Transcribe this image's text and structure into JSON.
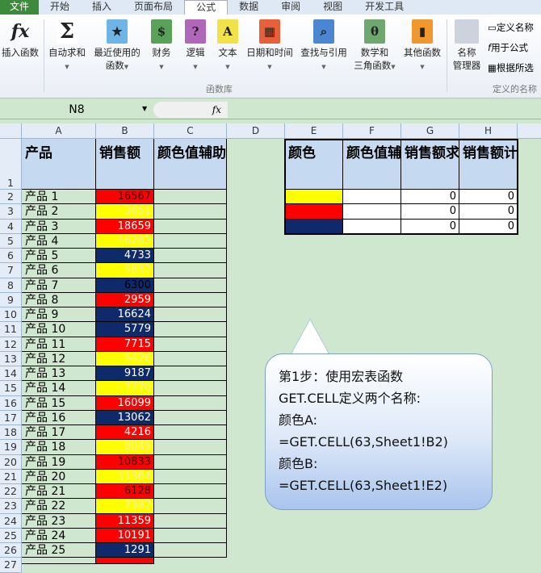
{
  "tabs": [
    "文件",
    "开始",
    "插入",
    "页面布局",
    "公式",
    "数据",
    "审阅",
    "视图",
    "开发工具"
  ],
  "ribbon": {
    "insert_function": "插入函数",
    "buttons": [
      {
        "l1": "自动求和",
        "l2": ""
      },
      {
        "l1": "最近使用的",
        "l2": "函数"
      },
      {
        "l1": "财务",
        "l2": ""
      },
      {
        "l1": "逻辑",
        "l2": ""
      },
      {
        "l1": "文本",
        "l2": ""
      },
      {
        "l1": "日期和时间",
        "l2": ""
      },
      {
        "l1": "查找与引用",
        "l2": ""
      },
      {
        "l1": "数学和",
        "l2": "三角函数"
      },
      {
        "l1": "其他函数",
        "l2": ""
      }
    ],
    "group_library": "函数库",
    "name_manager_1": "名称",
    "name_manager_2": "管理器",
    "define_name": "定义名称",
    "use_in_formula": "用于公式",
    "create_from_selection": "根据所选",
    "group_names": "定义的名称"
  },
  "formula_bar": {
    "name_box": "N8",
    "fx": "fx",
    "value": ""
  },
  "columns": [
    "A",
    "B",
    "C",
    "D",
    "E",
    "F",
    "G",
    "H"
  ],
  "headers": {
    "A": "产品",
    "B": "销售额",
    "C": "颜色值辅助列",
    "E": "颜色",
    "F": "颜色值辅助列",
    "G": "销售额求和",
    "H": "销售额计数"
  },
  "rows": [
    {
      "p": "产品 1",
      "v": "16567",
      "c": "red",
      "t": "#3a0000"
    },
    {
      "p": "产品 2",
      "v": "3651",
      "c": "yellow",
      "t": "#f5f0a0"
    },
    {
      "p": "产品 3",
      "v": "18659",
      "c": "red",
      "t": "#ffffff"
    },
    {
      "p": "产品 4",
      "v": "16282",
      "c": "yellow",
      "t": "#f5f0a0"
    },
    {
      "p": "产品 5",
      "v": "4733",
      "c": "navy",
      "t": "#ffffff"
    },
    {
      "p": "产品 6",
      "v": "5837",
      "c": "yellow",
      "t": "#f5f0a0"
    },
    {
      "p": "产品 7",
      "v": "6300",
      "c": "navy",
      "t": "#000000"
    },
    {
      "p": "产品 8",
      "v": "2959",
      "c": "red",
      "t": "#ffffff"
    },
    {
      "p": "产品 9",
      "v": "16624",
      "c": "navy",
      "t": "#ffffff"
    },
    {
      "p": "产品 10",
      "v": "5779",
      "c": "navy",
      "t": "#ffffff"
    },
    {
      "p": "产品 11",
      "v": "7715",
      "c": "red",
      "t": "#ffffff"
    },
    {
      "p": "产品 12",
      "v": "5426",
      "c": "yellow",
      "t": "#f5f0a0"
    },
    {
      "p": "产品 13",
      "v": "9187",
      "c": "navy",
      "t": "#ffffff"
    },
    {
      "p": "产品 14",
      "v": "7770",
      "c": "yellow",
      "t": "#f5f0a0"
    },
    {
      "p": "产品 15",
      "v": "16099",
      "c": "red",
      "t": "#ffffff"
    },
    {
      "p": "产品 16",
      "v": "13062",
      "c": "navy",
      "t": "#ffffff"
    },
    {
      "p": "产品 17",
      "v": "4216",
      "c": "red",
      "t": "#ffffff"
    },
    {
      "p": "产品 18",
      "v": "8049",
      "c": "yellow",
      "t": "#f5f0a0"
    },
    {
      "p": "产品 19",
      "v": "10833",
      "c": "red",
      "t": "#3a0000"
    },
    {
      "p": "产品 20",
      "v": "11364",
      "c": "yellow",
      "t": "#f5f0a0"
    },
    {
      "p": "产品 21",
      "v": "6128",
      "c": "red",
      "t": "#3a0000"
    },
    {
      "p": "产品 22",
      "v": "7397",
      "c": "yellow",
      "t": "#f5f0a0"
    },
    {
      "p": "产品 23",
      "v": "11359",
      "c": "red",
      "t": "#ffffff"
    },
    {
      "p": "产品 24",
      "v": "10191",
      "c": "red",
      "t": "#ffffff"
    },
    {
      "p": "产品 25",
      "v": "1291",
      "c": "navy",
      "t": "#ffffff"
    }
  ],
  "summary": [
    {
      "c": "yellow",
      "sum": "0",
      "count": "0"
    },
    {
      "c": "red",
      "sum": "0",
      "count": "0"
    },
    {
      "c": "navy",
      "sum": "0",
      "count": "0"
    }
  ],
  "colors": {
    "yellow": "#ffff00",
    "red": "#ff0000",
    "navy": "#0f2a6b"
  },
  "callout": [
    "第1步：使用宏表函数",
    "GET.CELL定义两个名称:",
    "颜色A:",
    "=GET.CELL(63,Sheet1!B2)",
    "颜色B:",
    "=GET.CELL(63,Sheet1!E2)"
  ]
}
